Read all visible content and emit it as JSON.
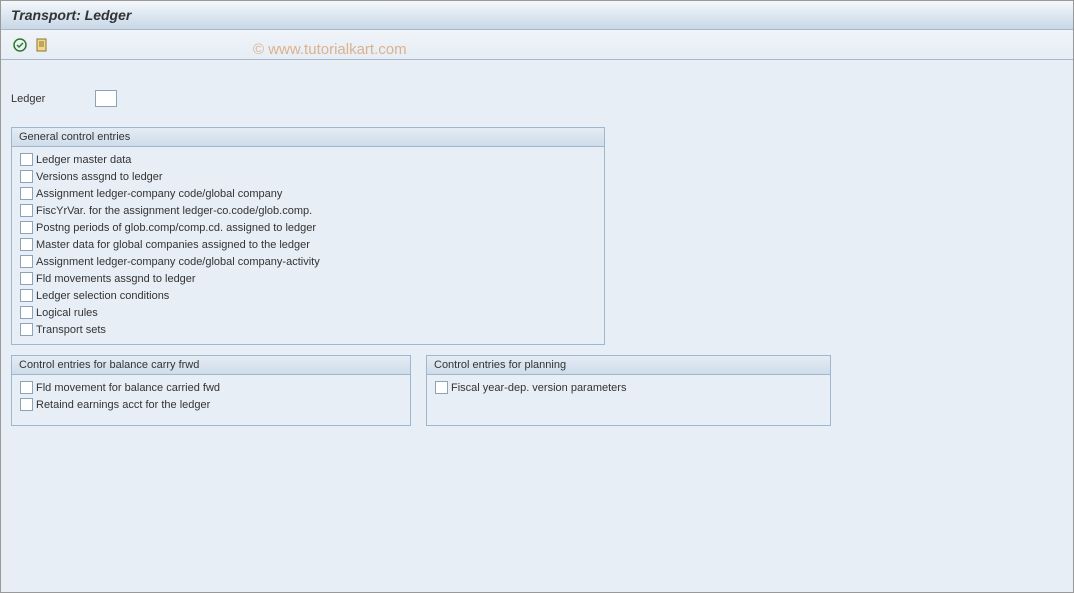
{
  "title": "Transport: Ledger",
  "watermark": "© www.tutorialkart.com",
  "ledger_field": {
    "label": "Ledger",
    "value": ""
  },
  "groups": {
    "general": {
      "title": "General control entries",
      "items": [
        "Ledger master data",
        "Versions assgnd to ledger",
        "Assignment ledger-company code/global company",
        "FiscYrVar. for the assignment ledger-co.code/glob.comp.",
        "Postng periods of glob.comp/comp.cd. assigned to ledger",
        "Master data for global companies assigned to the ledger",
        "Assignment ledger-company code/global company-activity",
        "Fld movements assgnd to ledger",
        "Ledger selection conditions",
        "Logical rules",
        "Transport sets"
      ]
    },
    "balance": {
      "title": "Control entries for balance carry frwd",
      "items": [
        "Fld movement for balance carried fwd",
        "Retaind earnings acct for the ledger"
      ]
    },
    "planning": {
      "title": "Control entries for planning",
      "items": [
        "Fiscal year-dep. version parameters"
      ]
    }
  }
}
